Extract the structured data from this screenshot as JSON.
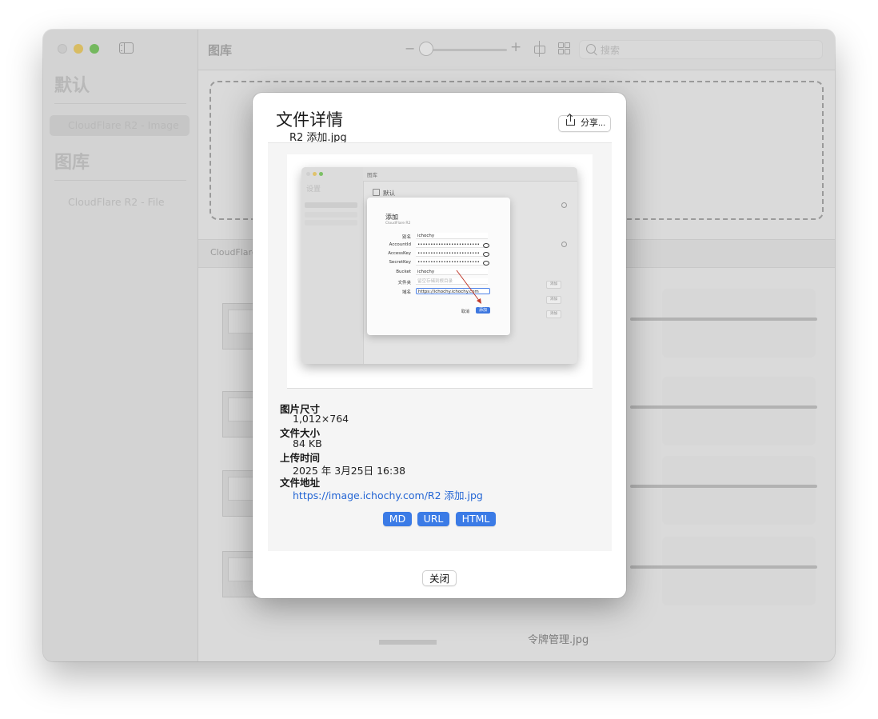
{
  "window": {
    "title": "图库",
    "search_placeholder": "搜索",
    "zoom_minus": "−",
    "zoom_plus": "+",
    "zoom_level": 0.0
  },
  "sidebar": {
    "sections": [
      {
        "title": "默认",
        "items": [
          {
            "label": "CloudFlare R2  -  Image",
            "selected": true
          }
        ]
      },
      {
        "title": "图库",
        "items": [
          {
            "label": "CloudFlare R2  -  File",
            "selected": false
          }
        ]
      }
    ]
  },
  "main": {
    "subbar_label": "CloudFlare",
    "bottom_file_name": "令牌管理.jpg"
  },
  "dialog": {
    "title": "文件详情",
    "file_name": "R2 添加.jpg",
    "share_label": "分享...",
    "preview": {
      "sidebar_title": "设置",
      "toolbar_title": "图库",
      "section_label": "默认",
      "row_buttons": [
        "添加",
        "添加",
        "添加"
      ],
      "form_title": "添加",
      "form_subtitle": "CloudFlare R2",
      "fields": [
        {
          "label": "别名",
          "value": "ichochy",
          "kind": "text"
        },
        {
          "label": "AccountId",
          "value": "••••••••••••••••••••••••",
          "kind": "secret"
        },
        {
          "label": "AccessKey",
          "value": "••••••••••••••••••••••••",
          "kind": "secret"
        },
        {
          "label": "SecretKey",
          "value": "••••••••••••••••••••••••",
          "kind": "secret"
        },
        {
          "label": "Bucket",
          "value": "ichochy",
          "kind": "text"
        },
        {
          "label": "文件夹",
          "value": "留空存储到根目录",
          "kind": "placeholder"
        },
        {
          "label": "域名",
          "value": "https://ichochy.ichochy.com",
          "kind": "focused"
        }
      ],
      "cancel_label": "取消",
      "add_label": "添加",
      "annotation_arrow_color": "#c0392b"
    },
    "info": {
      "size_label": "图片尺寸",
      "size_value": "1,012×764",
      "filesize_label": "文件大小",
      "filesize_value": "84 KB",
      "upload_label": "上传时间",
      "upload_value": "2025 年 3月25日 16:38",
      "url_label": "文件地址",
      "url_value": "https://image.ichochy.com/R2 添加.jpg"
    },
    "copy_buttons": [
      "MD",
      "URL",
      "HTML"
    ],
    "close_label": "关闭"
  },
  "colors": {
    "accent": "#3b7be6",
    "link": "#2566d4",
    "traffic_minimize": "#d8bc63",
    "traffic_maximize": "#74b85e"
  }
}
